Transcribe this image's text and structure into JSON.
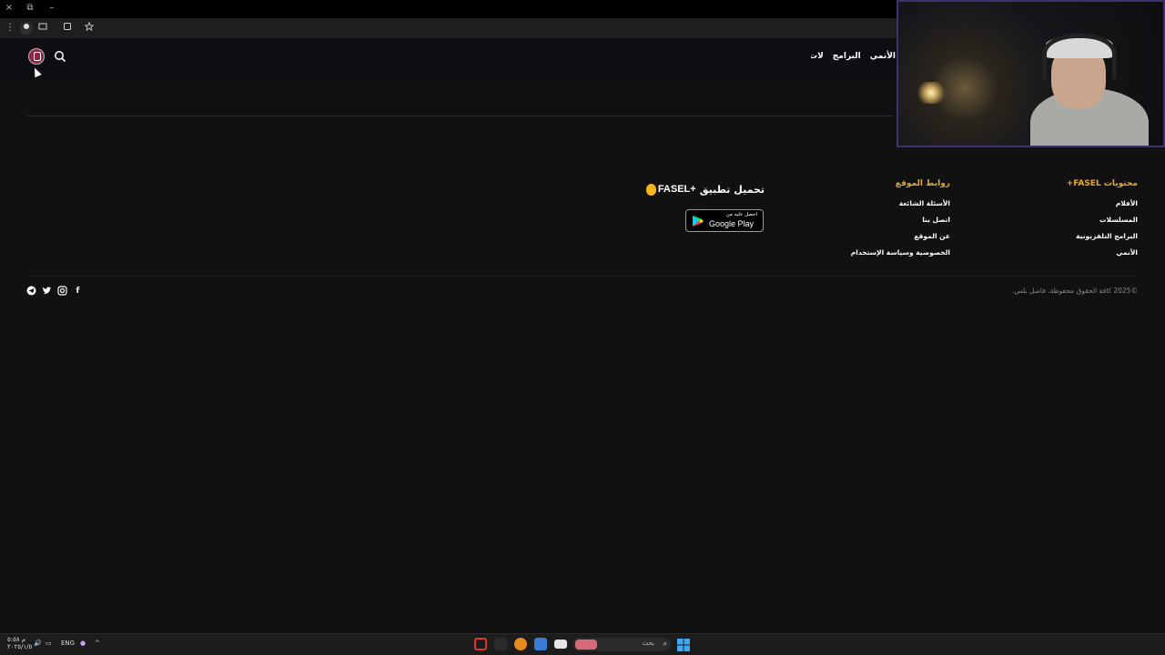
{
  "window": {
    "close_glyph": "×",
    "restore_glyph": "⧉",
    "min_glyph": "–"
  },
  "browser": {
    "menu_icon": "⋮",
    "toolbar_icons": [
      "extension-icon",
      "bookmark-star-icon"
    ]
  },
  "header": {
    "nav_items": [
      "الأنمي",
      "البرامج",
      "لات"
    ]
  },
  "footer": {
    "col_content": {
      "title": "محتويات FASEL+",
      "links": [
        "الأفلام",
        "المسلسلات",
        "البرامج التلفزيونية",
        "الأنمي"
      ]
    },
    "col_links": {
      "title": "روابط الموقع",
      "links": [
        "الأسئلة الشائعة",
        "اتصل بنا",
        "عن الموقع",
        "الخصوصية وسياسة الإستخدام"
      ]
    },
    "app": {
      "title": "تحميل تطبيق",
      "logo_text": "FASEL+",
      "store_small": "احصل عليه من",
      "store_big": "Google Play"
    },
    "copyright": "©2025 كافة الحقوق محفوظة. فاصل بلس.",
    "social": [
      "f",
      "◎",
      "🐦",
      "➤"
    ]
  },
  "taskbar": {
    "lang": "ENG",
    "search_placeholder": "بحث",
    "clock_time": "م ٥:٥٨",
    "clock_date": "٢٠٢٥/١/٥"
  }
}
